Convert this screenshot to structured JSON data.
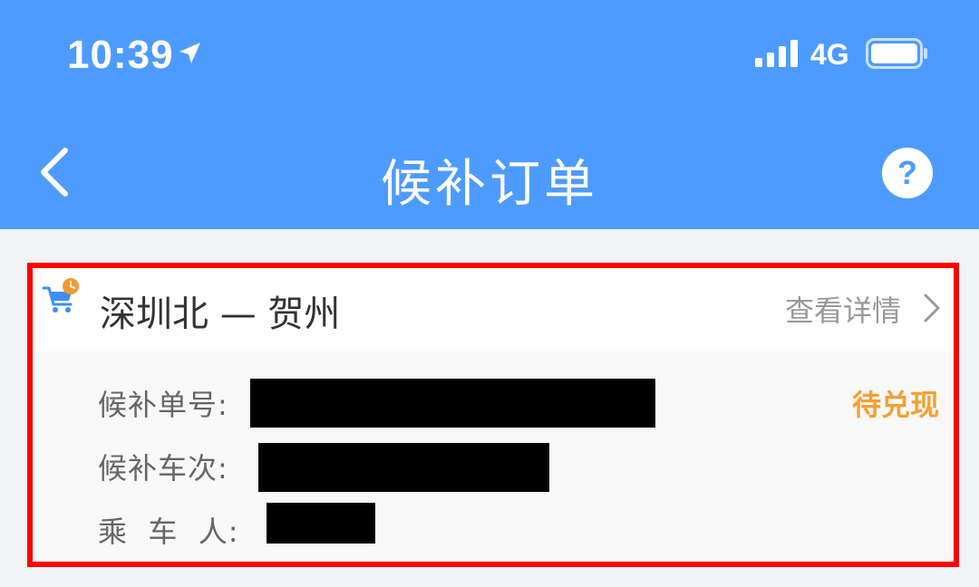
{
  "status_bar": {
    "time": "10:39",
    "network": "4G",
    "icons": [
      "location-arrow-icon",
      "signal-bars-icon",
      "battery-icon"
    ]
  },
  "nav": {
    "title": "候补订单",
    "back_icon": "chevron-left-icon",
    "help_icon": "question-circle-icon"
  },
  "order": {
    "route": "深圳北 — 贺州",
    "detail_link": "查看详情",
    "status": "待兑现",
    "fields": [
      {
        "label": "候补单号:",
        "value": ""
      },
      {
        "label": "候补车次:",
        "value": ""
      },
      {
        "label": "乘  车  人:",
        "value": ""
      }
    ]
  },
  "colors": {
    "header": "#4e9bff",
    "status": "#f5a030",
    "highlight": "#ff0000"
  }
}
